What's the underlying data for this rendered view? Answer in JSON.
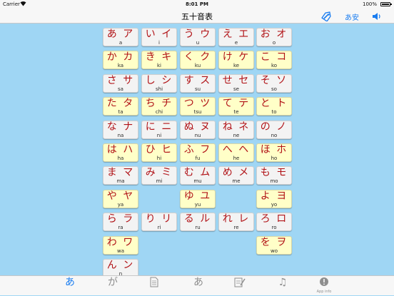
{
  "status_bar": {
    "carrier": "Carrier",
    "time": "8:01 PM",
    "battery": "100%"
  },
  "nav_bar": {
    "title": "五十音表",
    "kana_button": "あ安"
  },
  "rows": [
    [
      {
        "kana": "あ ア",
        "romaji": "a",
        "style": "white"
      },
      {
        "kana": "い イ",
        "romaji": "i",
        "style": "white"
      },
      {
        "kana": "う ウ",
        "romaji": "u",
        "style": "white"
      },
      {
        "kana": "え エ",
        "romaji": "e",
        "style": "white"
      },
      {
        "kana": "お オ",
        "romaji": "o",
        "style": "white"
      }
    ],
    [
      {
        "kana": "か カ",
        "romaji": "ka",
        "style": "yellow"
      },
      {
        "kana": "き キ",
        "romaji": "ki",
        "style": "yellow"
      },
      {
        "kana": "く ク",
        "romaji": "ku",
        "style": "yellow"
      },
      {
        "kana": "け ケ",
        "romaji": "ke",
        "style": "yellow"
      },
      {
        "kana": "こ コ",
        "romaji": "ko",
        "style": "yellow"
      }
    ],
    [
      {
        "kana": "さ サ",
        "romaji": "sa",
        "style": "white"
      },
      {
        "kana": "し シ",
        "romaji": "shi",
        "style": "white"
      },
      {
        "kana": "す ス",
        "romaji": "su",
        "style": "white"
      },
      {
        "kana": "せ セ",
        "romaji": "se",
        "style": "white"
      },
      {
        "kana": "そ ソ",
        "romaji": "so",
        "style": "white"
      }
    ],
    [
      {
        "kana": "た タ",
        "romaji": "ta",
        "style": "yellow"
      },
      {
        "kana": "ち チ",
        "romaji": "chi",
        "style": "yellow"
      },
      {
        "kana": "つ ツ",
        "romaji": "tsu",
        "style": "yellow"
      },
      {
        "kana": "て テ",
        "romaji": "te",
        "style": "yellow"
      },
      {
        "kana": "と ト",
        "romaji": "to",
        "style": "yellow"
      }
    ],
    [
      {
        "kana": "な ナ",
        "romaji": "na",
        "style": "white"
      },
      {
        "kana": "に ニ",
        "romaji": "ni",
        "style": "white"
      },
      {
        "kana": "ぬ ヌ",
        "romaji": "nu",
        "style": "white"
      },
      {
        "kana": "ね ネ",
        "romaji": "ne",
        "style": "white"
      },
      {
        "kana": "の ノ",
        "romaji": "no",
        "style": "white"
      }
    ],
    [
      {
        "kana": "は ハ",
        "romaji": "ha",
        "style": "yellow"
      },
      {
        "kana": "ひ ヒ",
        "romaji": "hi",
        "style": "yellow"
      },
      {
        "kana": "ふ フ",
        "romaji": "fu",
        "style": "yellow"
      },
      {
        "kana": "へ ヘ",
        "romaji": "he",
        "style": "yellow"
      },
      {
        "kana": "ほ ホ",
        "romaji": "ho",
        "style": "yellow"
      }
    ],
    [
      {
        "kana": "ま マ",
        "romaji": "ma",
        "style": "white"
      },
      {
        "kana": "み ミ",
        "romaji": "mi",
        "style": "white"
      },
      {
        "kana": "む ム",
        "romaji": "mu",
        "style": "white"
      },
      {
        "kana": "め メ",
        "romaji": "me",
        "style": "white"
      },
      {
        "kana": "も モ",
        "romaji": "mo",
        "style": "white"
      }
    ],
    [
      {
        "kana": "や ヤ",
        "romaji": "ya",
        "style": "yellow"
      },
      null,
      {
        "kana": "ゆ ユ",
        "romaji": "yu",
        "style": "yellow"
      },
      null,
      {
        "kana": "よ ヨ",
        "romaji": "yo",
        "style": "yellow"
      }
    ],
    [
      {
        "kana": "ら ラ",
        "romaji": "ra",
        "style": "white"
      },
      {
        "kana": "り リ",
        "romaji": "ri",
        "style": "white"
      },
      {
        "kana": "る ル",
        "romaji": "ru",
        "style": "white"
      },
      {
        "kana": "れ レ",
        "romaji": "re",
        "style": "white"
      },
      {
        "kana": "ろ ロ",
        "romaji": "ro",
        "style": "white"
      }
    ],
    [
      {
        "kana": "わ ワ",
        "romaji": "wa",
        "style": "yellow"
      },
      null,
      null,
      null,
      {
        "kana": "を ヲ",
        "romaji": "wo",
        "style": "yellow"
      }
    ],
    [
      {
        "kana": "ん ン",
        "romaji": "n",
        "style": "white"
      },
      null,
      null,
      null,
      null
    ]
  ],
  "tabs": [
    {
      "icon": "hiragana-a-icon",
      "glyph": "あ",
      "label": "",
      "active": true
    },
    {
      "icon": "hiragana-ga-icon",
      "glyph": "が",
      "label": "",
      "active": false
    },
    {
      "icon": "document-icon",
      "glyph": "",
      "label": "",
      "active": false
    },
    {
      "icon": "handwriting-icon",
      "glyph": "あ",
      "label": "",
      "active": false
    },
    {
      "icon": "writing-practice-icon",
      "glyph": "",
      "label": "",
      "active": false
    },
    {
      "icon": "music-note-icon",
      "glyph": "♫",
      "label": "",
      "active": false
    },
    {
      "icon": "info-icon",
      "glyph": "",
      "label": "App info",
      "active": false
    }
  ],
  "colors": {
    "background": "#9fd6f4",
    "kana_red": "#b11216",
    "cell_yellow": "#ffffc8",
    "cell_white": "#f3f3f3",
    "accent_blue": "#1a7df0"
  }
}
